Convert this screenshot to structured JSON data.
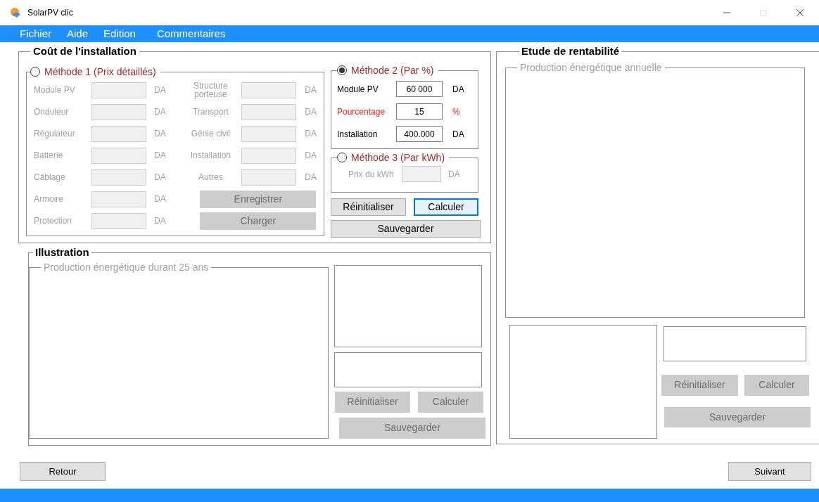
{
  "window": {
    "title": "SolarPV clic"
  },
  "menu": [
    {
      "label": "Fichier"
    },
    {
      "label": "Aide"
    },
    {
      "label": "Edition"
    },
    {
      "label": "Commentaires"
    }
  ],
  "cost": {
    "title": "Coût de l'installation",
    "method1": {
      "label": "Méthode 1 (Prix détaillés)",
      "selected": false,
      "left_fields": [
        {
          "label": "Module PV",
          "unit": "DA"
        },
        {
          "label": "Onduleur",
          "unit": "DA"
        },
        {
          "label": "Régulateur",
          "unit": "DA"
        },
        {
          "label": "Batterie",
          "unit": "DA"
        },
        {
          "label": "Câblage",
          "unit": "DA"
        },
        {
          "label": "Armoire",
          "unit": "DA"
        },
        {
          "label": "Protection",
          "unit": "DA"
        }
      ],
      "right_fields": [
        {
          "label": "Structure porteuse",
          "unit": "DA"
        },
        {
          "label": "Transport",
          "unit": "DA"
        },
        {
          "label": "Génie civil",
          "unit": "DA"
        },
        {
          "label": "Installation",
          "unit": "DA"
        },
        {
          "label": "Autres",
          "unit": "DA"
        }
      ],
      "buttons": [
        {
          "label": "Enregistrer",
          "disabled": true
        },
        {
          "label": "Charger",
          "disabled": true
        }
      ]
    },
    "method2": {
      "label": "Méthode 2 (Par %)",
      "selected": true,
      "fields": [
        {
          "label": "Module PV",
          "value": "60 000",
          "unit": "DA",
          "color": "#000000"
        },
        {
          "label": "Pourcentage",
          "value": "15",
          "unit": "%",
          "color": "#ff1a1a"
        },
        {
          "label": "Installation",
          "value": "400.000",
          "unit": "DA",
          "color": "#000000"
        }
      ]
    },
    "method3": {
      "label": "Méthode 3 (Par kWh)",
      "selected": false,
      "fields": [
        {
          "label": "Prix du kWh",
          "unit": "DA"
        }
      ]
    },
    "buttons": [
      {
        "label": "Réinitialiser",
        "disabled": false,
        "focused": false
      },
      {
        "label": "Calculer",
        "disabled": false,
        "focused": true
      },
      {
        "label": "Sauvegarder",
        "disabled": false,
        "focused": false
      }
    ]
  },
  "illustration": {
    "title": "Illustration",
    "chart_title": "Production énergétique durant 25 ans",
    "buttons": [
      {
        "label": "Réinitialiser",
        "disabled": true
      },
      {
        "label": "Calculer",
        "disabled": true
      },
      {
        "label": "Sauvegarder",
        "disabled": true
      }
    ]
  },
  "rentabilite": {
    "title": "Etude de rentabilité",
    "chart_title": "Production énergétique annuelle",
    "buttons": [
      {
        "label": "Réinitialiser",
        "disabled": true
      },
      {
        "label": "Calculer",
        "disabled": true
      },
      {
        "label": "Sauvegarder",
        "disabled": true
      }
    ]
  },
  "nav": [
    {
      "label": "Retour"
    },
    {
      "label": "Suivant"
    }
  ]
}
